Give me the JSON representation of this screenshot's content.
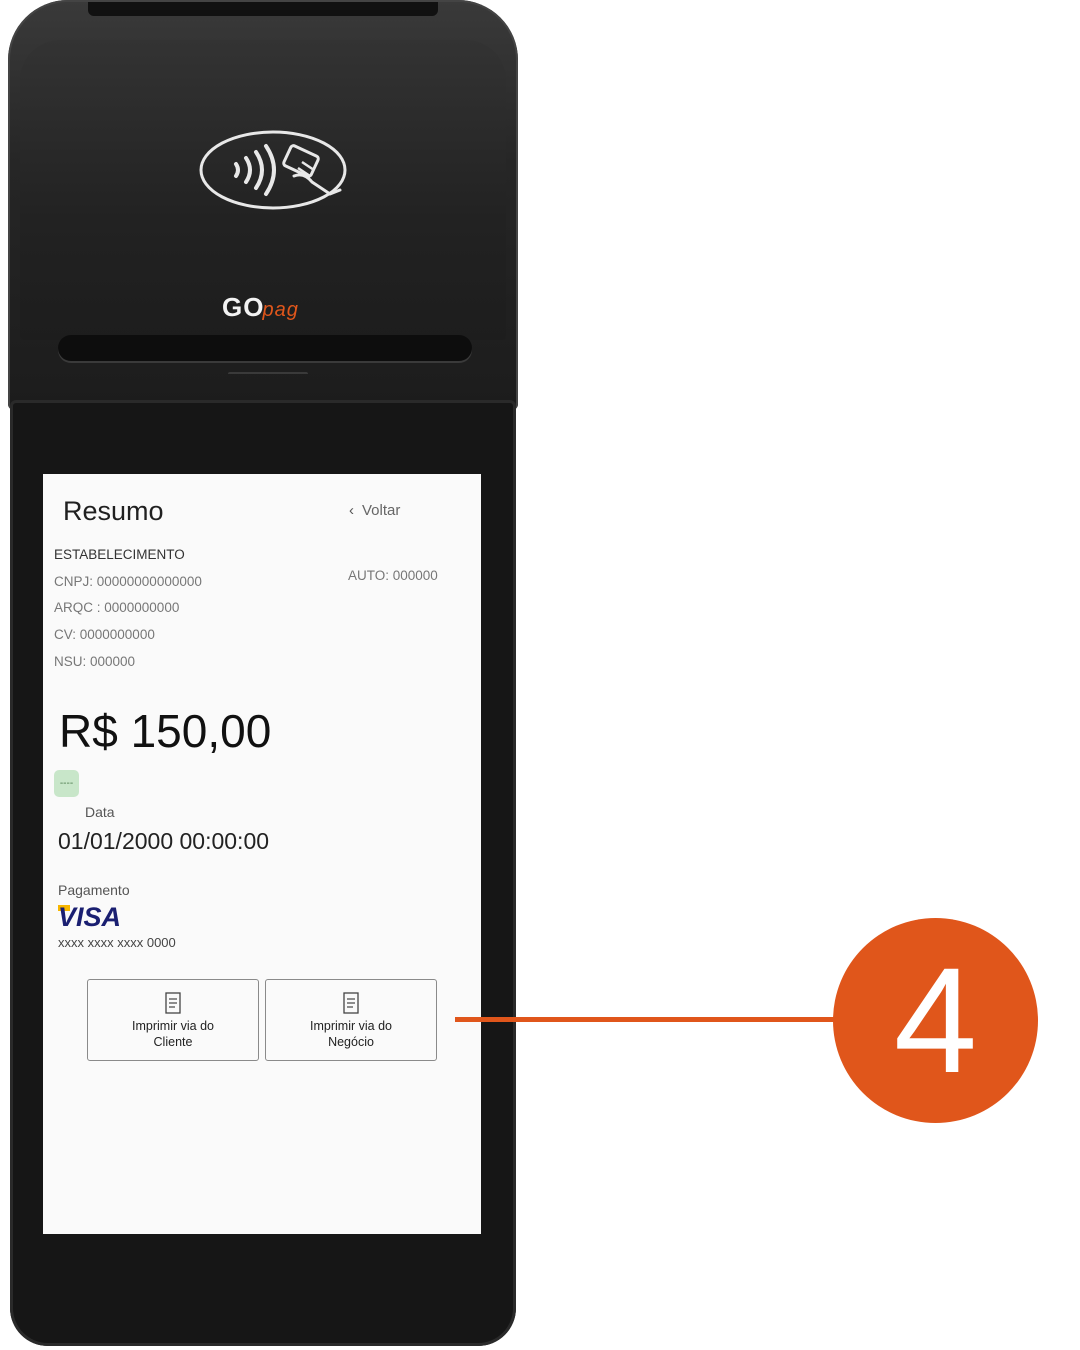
{
  "device": {
    "brand_logo": "GO",
    "brand_sub": "pag",
    "brand_color": "#e0561b"
  },
  "screen": {
    "title": "Resumo",
    "back_label": "Voltar",
    "establishment": "ESTABELECIMENTO",
    "cnpj": "CNPJ: 00000000000000",
    "arqc": "ARQC : 0000000000",
    "cv": "CV: 0000000000",
    "nsu": "NSU: 000000",
    "auto": "AUTO: 000000",
    "amount": "R$ 150,00",
    "status_badge": "----",
    "date_label": "Data",
    "date_value": "01/01/2000 00:00:00",
    "payment_label": "Pagamento",
    "card_brand": "VISA",
    "card_number": "xxxx  xxxx  xxxx  0000",
    "buttons": [
      {
        "label": "Imprimir via do\nCliente",
        "icon": "receipt-icon"
      },
      {
        "label": "Imprimir via do\nNegócio",
        "icon": "receipt-icon"
      }
    ]
  },
  "callout": {
    "number": "4",
    "color": "#e0561b"
  }
}
